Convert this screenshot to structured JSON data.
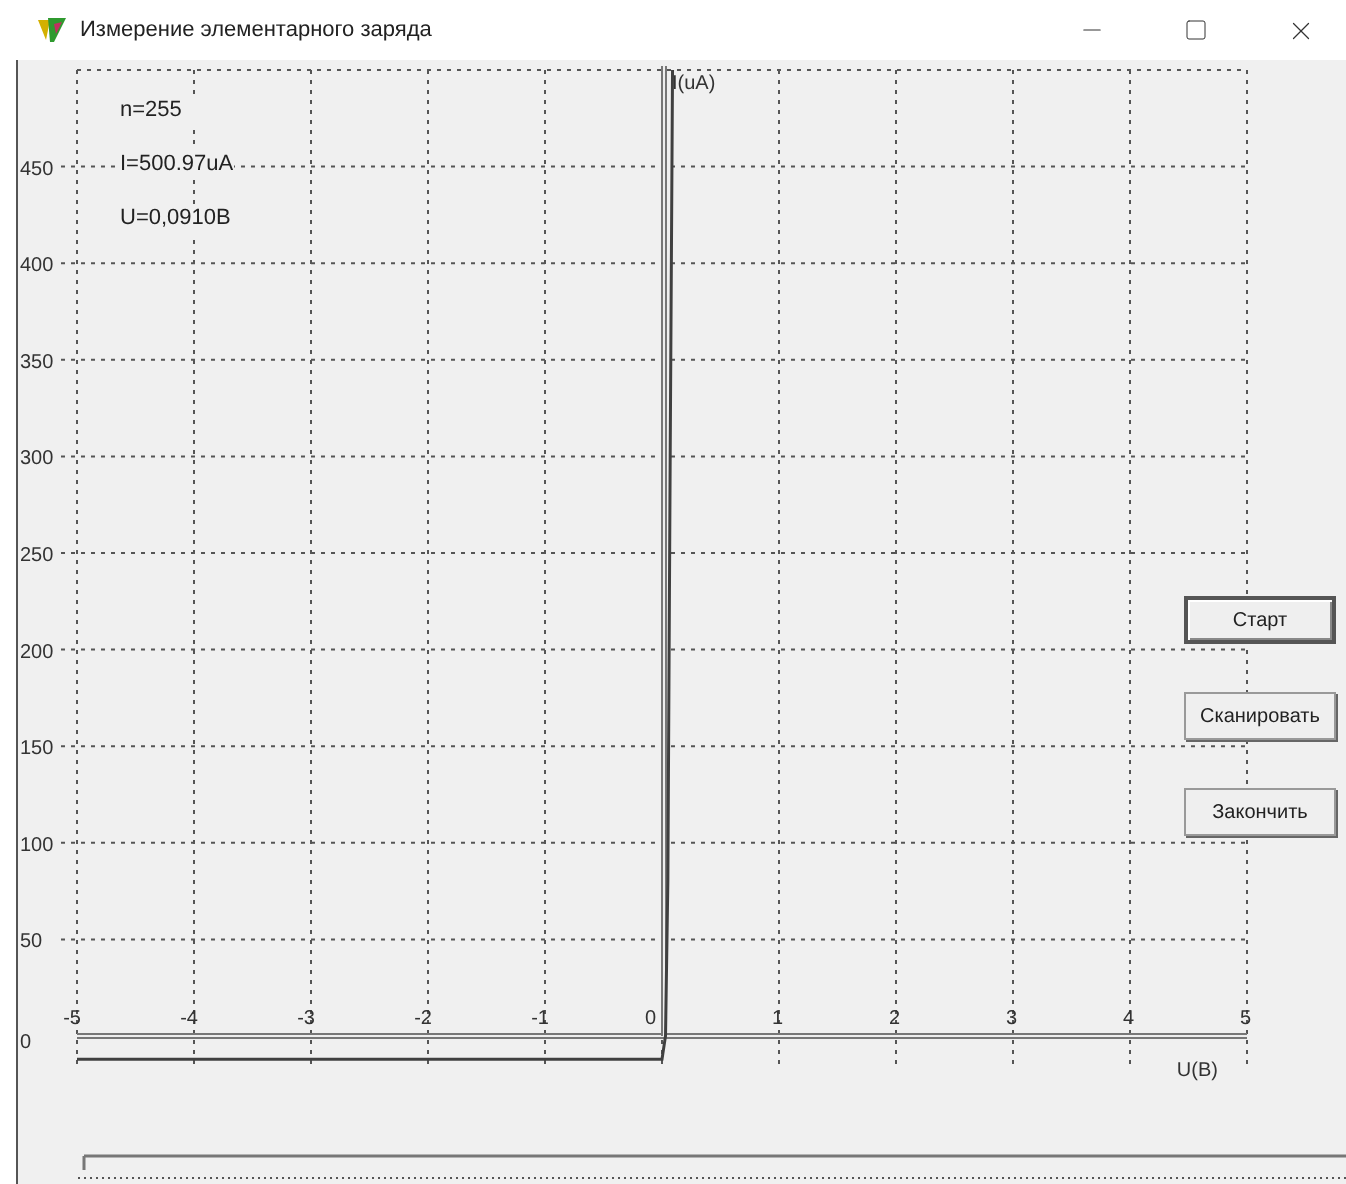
{
  "window": {
    "title": "Измерение элементарного заряда"
  },
  "readouts": [
    "n=255",
    "I=500.97uA",
    "U=0,0910В"
  ],
  "plot": {
    "chart_data": {
      "type": "line",
      "xlabel": "U(B)",
      "ylabel": "I(uA)",
      "xlim": [
        -5,
        5
      ],
      "ylim": [
        -15,
        500
      ],
      "grid": true,
      "xticks": [
        -5,
        -4,
        -3,
        -2,
        -1,
        0,
        1,
        2,
        3,
        4,
        5
      ],
      "yticks": [
        0,
        50,
        100,
        150,
        200,
        250,
        300,
        350,
        400,
        450
      ],
      "x": [
        -5,
        0,
        0.03,
        0.05,
        0.07,
        0.09
      ],
      "series": [
        {
          "color": "#404040",
          "values": [
            -12,
            -12,
            0,
            80,
            300,
            500
          ]
        }
      ]
    }
  },
  "buttons": [
    {
      "label": "Старт",
      "focused": true
    },
    {
      "label": "Сканировать",
      "focused": false
    },
    {
      "label": "Закончить",
      "focused": false
    }
  ]
}
